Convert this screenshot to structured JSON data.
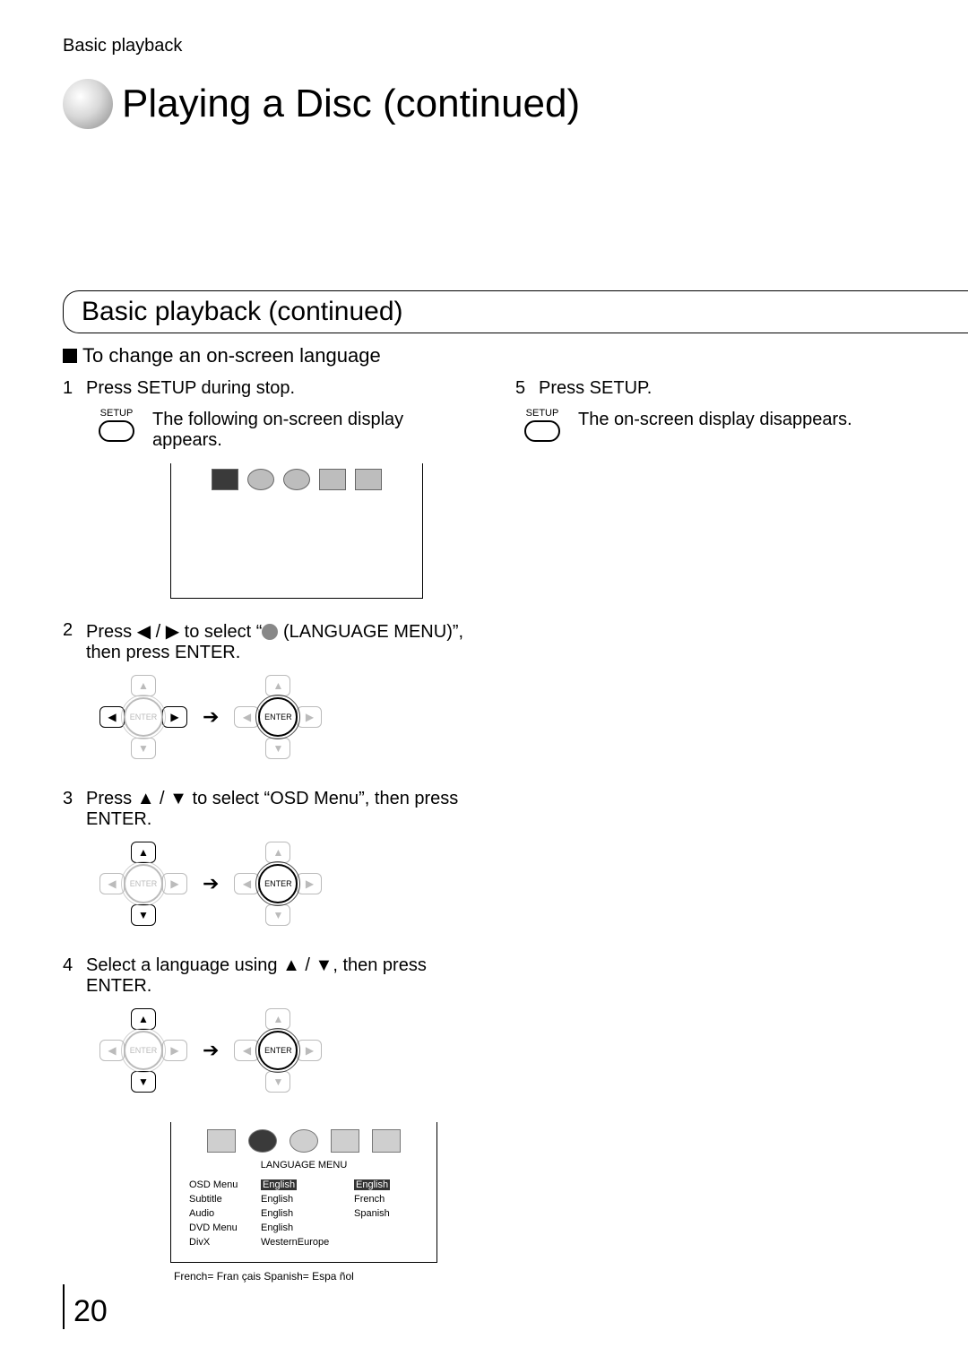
{
  "breadcrumb": "Basic playback",
  "page_title": "Playing a Disc (continued)",
  "section_title": "Basic playback (continued)",
  "sub_heading": "To change an on-screen language",
  "setup_label": "SETUP",
  "enter_label": "ENTER",
  "steps_left": [
    {
      "num": "1",
      "text": "Press SETUP during stop."
    },
    {
      "num": "2",
      "text_pre": "Press ",
      "text_mid": " to select “",
      "text_post": " (LANGUAGE MENU)”, then press ENTER.",
      "arrows": "◀ / ▶"
    },
    {
      "num": "3",
      "text_pre": "Press ",
      "text_post": " to select “OSD Menu”, then press ENTER.",
      "arrows": "▲ / ▼"
    },
    {
      "num": "4",
      "text_pre": "Select a language using ",
      "text_post": ", then press ENTER.",
      "arrows": "▲ / ▼"
    }
  ],
  "step1_caption": "The following on-screen display appears.",
  "steps_right": [
    {
      "num": "5",
      "text": "Press SETUP."
    }
  ],
  "step5_caption": "The on-screen display disappears.",
  "lang_menu": {
    "title": "LANGUAGE MENU",
    "col1": [
      "OSD Menu",
      "Subtitle",
      "Audio",
      "DVD Menu",
      "DivX"
    ],
    "col2": [
      "English",
      "English",
      "English",
      "English",
      "WesternEurope"
    ],
    "col3": [
      "English",
      "French",
      "Spanish"
    ]
  },
  "lang_footnote": "French= Fran çais  Spanish= Espa ñol",
  "page_number": "20"
}
